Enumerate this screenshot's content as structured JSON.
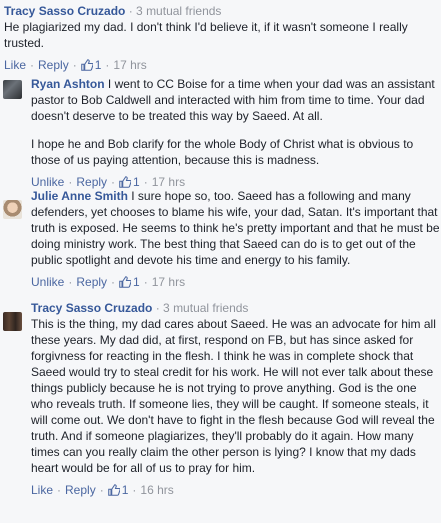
{
  "comments": [
    {
      "author": "Tracy Sasso Cruzado",
      "meta": " · 3 mutual friends",
      "paragraphs": [
        "He plagiarized my dad. I don't think I'd believe it, if it wasn't someone I really trusted."
      ],
      "like": "Like",
      "reply": "Reply",
      "likes_count": "1",
      "time": "17 hrs"
    },
    {
      "author": "Ryan Ashton",
      "meta": "",
      "paragraphs": [
        "I went to CC Boise for a time when your dad was an assistant pastor to Bob Caldwell and interacted with him from time to time. Your dad doesn't deserve to be treated this way by Saeed. At all.",
        "I hope he and Bob clarify for the whole Body of Christ what is obvious to those of us paying attention, because this is madness."
      ],
      "like": "Unlike",
      "reply": "Reply",
      "likes_count": "1",
      "time": "17 hrs"
    },
    {
      "author": "Julie Anne Smith",
      "meta": "",
      "paragraphs": [
        "I sure hope so, too. Saeed has a following and many defenders, yet chooses to blame his wife, your dad, Satan. It's important that truth is exposed. He seems to think he's pretty important and that he must be doing ministry work. The best thing that Saeed can do is to get out of the public spotlight and devote his time and energy to his family."
      ],
      "like": "Unlike",
      "reply": "Reply",
      "likes_count": "1",
      "time": "17 hrs"
    },
    {
      "author": "Tracy Sasso Cruzado",
      "meta": " · 3 mutual friends",
      "paragraphs": [
        "This is the thing, my dad cares about Saeed. He was an advocate for him all these years. My dad did, at first, respond on FB, but has since asked for forgivness for reacting in the flesh. I think he was in complete shock that Saeed would try to steal credit for his work. He will not ever talk about these things publicly because he is not trying to prove anything. God is the one who reveals truth. If someone lies, they will be caught. If someone steals, it will come out. We don't have to fight in the flesh because God will reveal the truth. And if someone plagiarizes, they'll probably do it again. How many times can you really claim the other person is lying? I know that my dads heart would be for all of us to pray for him."
      ],
      "like": "Like",
      "reply": "Reply",
      "likes_count": "1",
      "time": "16 hrs"
    }
  ],
  "colors": {
    "link": "#365899",
    "meta": "#90949c",
    "text": "#1d2129",
    "background": "#f6f7f9"
  },
  "icons": {
    "like_badge": "thumbs-up-icon"
  }
}
